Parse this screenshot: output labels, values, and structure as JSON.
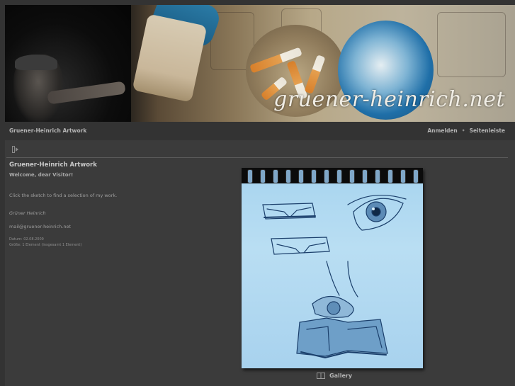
{
  "banner": {
    "site_name": "gruener-heinrich.net"
  },
  "navbar": {
    "brand": "Gruener-Heinrich Artwork",
    "login": "Anmelden",
    "separator": "•",
    "sidebar": "Seitenleiste"
  },
  "main": {
    "title": "Gruener-Heinrich Artwork",
    "welcome": "Welcome, dear Visitor!",
    "intro": "Click the sketch to find a selection of my work.",
    "author": "Grüner Heinrich",
    "email": "mail@gruener-heinrich.net",
    "meta_date": "Datum: 02.08.2009",
    "meta_size": "Größe: 1 Element (insgesamt 1 Element)"
  },
  "gallery": {
    "caption": "Gallery",
    "icon": "album-icon"
  },
  "colors": {
    "background": "#333333",
    "panel": "#3b3b3b",
    "sketch_blue": "#a9d5ef"
  }
}
